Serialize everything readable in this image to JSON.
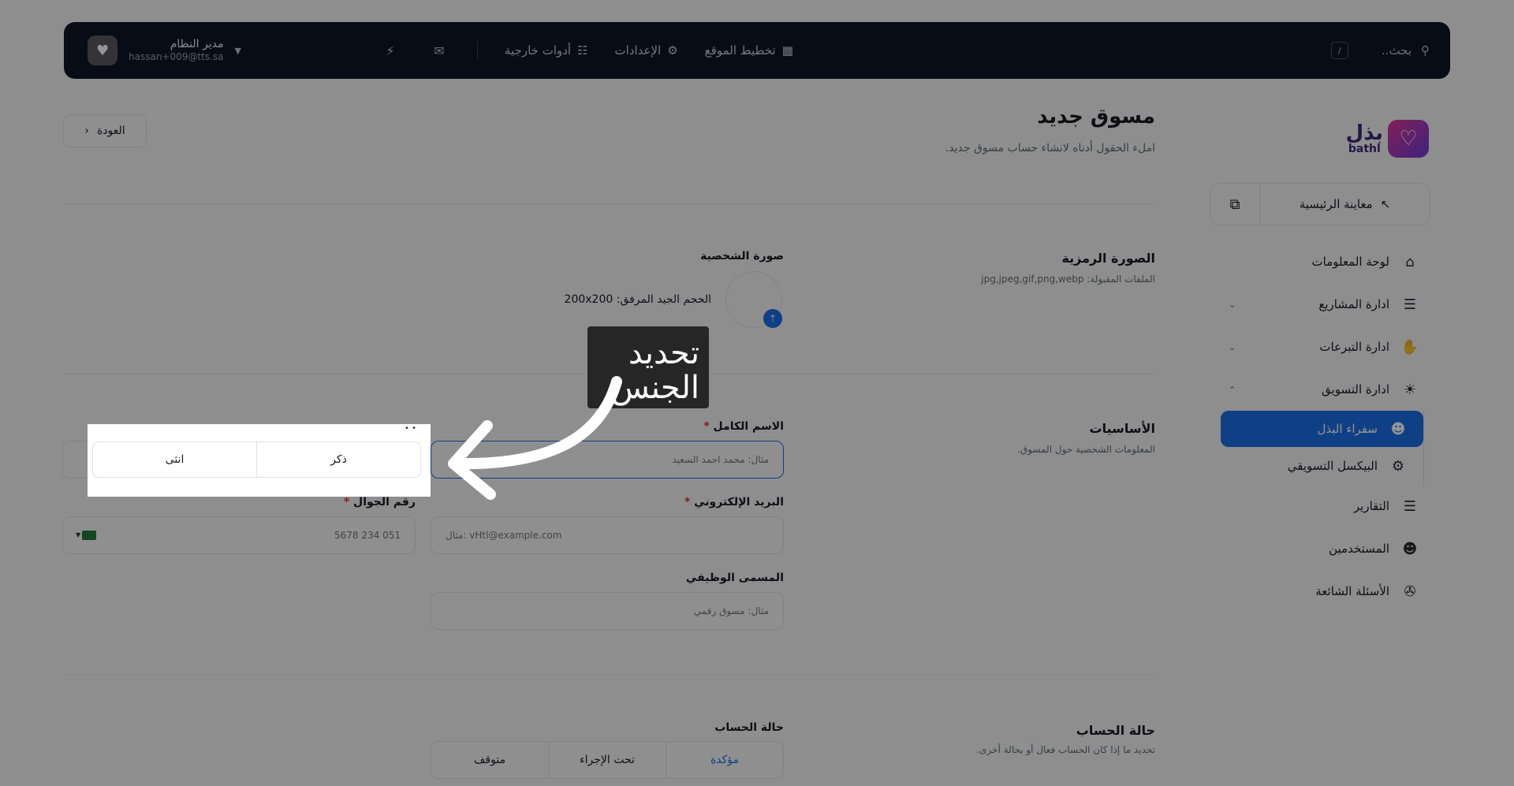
{
  "header": {
    "search_placeholder": "بحث..",
    "search_key": "/",
    "nav": [
      {
        "label": "تخطيط الموقع",
        "icon": "layout-icon"
      },
      {
        "label": "الإعدادات",
        "icon": "gear-icon"
      },
      {
        "label": "أدوات خارجية",
        "icon": "grid-icon"
      }
    ],
    "user_name": "مدير النظام",
    "user_email": "hassan+009@tts.sa"
  },
  "brand": {
    "name_ar": "بذل",
    "name_en": "bathl"
  },
  "sidebar": {
    "preview_label": "معاينة الرئيسية",
    "items": [
      {
        "label": "لوحة المعلومات",
        "icon": "home-icon"
      },
      {
        "label": "ادارة المشاريع",
        "icon": "stack-icon",
        "chevron": "down"
      },
      {
        "label": "ادارة التبرعات",
        "icon": "hand-icon",
        "chevron": "down"
      },
      {
        "label": "ادارة التسويق",
        "icon": "sun-icon",
        "chevron": "up"
      }
    ],
    "sub_items": [
      {
        "label": "سفراء البذل",
        "icon": "users-icon",
        "active": true
      },
      {
        "label": "البيكسل التسويقي",
        "icon": "gear-icon",
        "active": false
      }
    ],
    "bottom_items": [
      {
        "label": "التقارير",
        "icon": "stack-icon"
      },
      {
        "label": "المستخدمين",
        "icon": "users-icon"
      },
      {
        "label": "الأسئلة الشائعة",
        "icon": "chat-icon"
      }
    ]
  },
  "page": {
    "back_label": "العودة",
    "title": "مسوق جديد",
    "subtitle": "املء الحقول أدناه لانشاء حساب مسوق جديد."
  },
  "logo_section": {
    "title": "الصورة الرمزية",
    "desc": "الملفات المقبولة: jpg,jpeg,gif,png,webp",
    "photo_label": "صورة الشخصية",
    "size_hint": "الحجم الجيد المرفق: 200x200"
  },
  "basics": {
    "title": "الأساسيات",
    "desc": "المعلومات الشخصية حول المسوق.",
    "fullname_label": "الاسم الكامل",
    "fullname_placeholder": "مثال: محمد احمد السعيد",
    "email_label": "البريد الإلكتروني",
    "email_placeholder": "مثال: vHtl@example.com",
    "phone_label": "رقم الجوال",
    "phone_placeholder": "051 234 5678",
    "job_label": "المسمى الوظيفي",
    "job_placeholder": "مثال: مسوق رقمي",
    "gender_options": [
      "ذكر",
      "انثى"
    ]
  },
  "status_section": {
    "title": "حالة الحساب",
    "desc": "تحديد ما إذا كان الحساب فعال أو بحالة أخرى.",
    "field_label": "حالة الحساب",
    "options": [
      "مؤكدة",
      "تحت الإجراء",
      "متوقف"
    ],
    "selected": "مؤكدة"
  },
  "annotation": {
    "line1": "تحديد",
    "line2": "الجنس"
  },
  "colors": {
    "accent": "#1a6ee6",
    "header_bg": "#0f1629",
    "required": "#e03a3a"
  }
}
